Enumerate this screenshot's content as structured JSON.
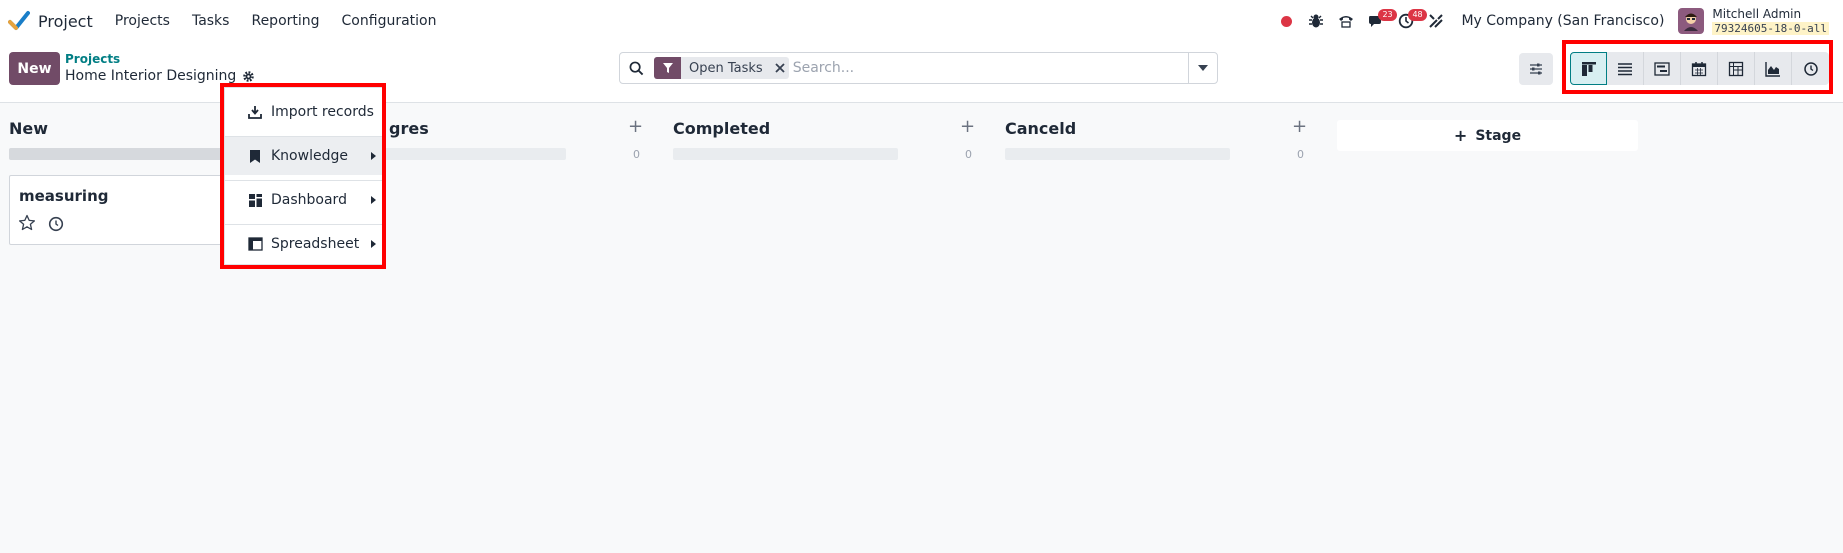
{
  "navbar": {
    "app_name": "Project",
    "menu": [
      "Projects",
      "Tasks",
      "Reporting",
      "Configuration"
    ],
    "icons": {
      "recording": "recording-dot-icon",
      "debug": "bug-icon",
      "voip": "phone-icon",
      "messages": "chat-icon",
      "activities": "clock-icon",
      "tools": "tools-icon"
    },
    "messages_count": "23",
    "activities_count": "48",
    "company": "My Company (San Francisco)",
    "user_name": "Mitchell Admin",
    "database": "79324605-18-0-all"
  },
  "control_panel": {
    "new_label": "New",
    "breadcrumb_parent": "Projects",
    "breadcrumb_current": "Home Interior Designing",
    "search": {
      "facet": "Open Tasks",
      "placeholder": "Search..."
    },
    "views": [
      "kanban",
      "list",
      "gantt",
      "calendar",
      "pivot",
      "graph",
      "activity"
    ],
    "active_view": "kanban"
  },
  "kanban": {
    "columns": [
      {
        "title": "New",
        "count": ""
      },
      {
        "title": "gres",
        "count": "0"
      },
      {
        "title": "Completed",
        "count": "0"
      },
      {
        "title": "Canceld",
        "count": "0"
      }
    ],
    "add_stage_label": "Stage",
    "card": {
      "title": "measuring"
    }
  },
  "gear_menu": {
    "items": [
      {
        "label": "Import records",
        "icon": "download-icon",
        "submenu": false
      },
      {
        "label": "Knowledge",
        "icon": "bookmark-icon",
        "submenu": true
      },
      {
        "label": "Dashboard",
        "icon": "dashboard-icon",
        "submenu": true
      },
      {
        "label": "Spreadsheet",
        "icon": "spreadsheet-icon",
        "submenu": true
      }
    ]
  },
  "colors": {
    "brand": "#714b67",
    "accent": "#017e84",
    "badge": "#dc3545",
    "highlight": "#ff0000"
  }
}
